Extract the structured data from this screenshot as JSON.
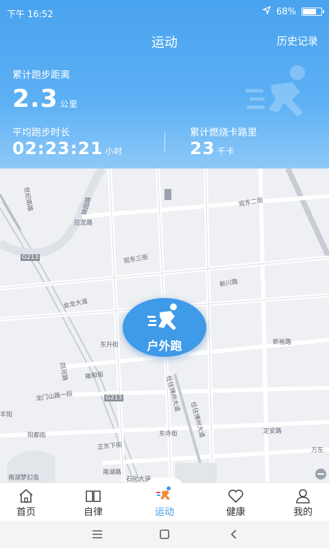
{
  "status": {
    "time": "下午 16:52",
    "battery": "68%",
    "battery_level": 0.68
  },
  "header": {
    "title": "运动",
    "history": "历史记录",
    "distance": {
      "label": "累计跑步距离",
      "value": "2.3",
      "unit": "公里"
    },
    "duration": {
      "label": "平均跑步时长",
      "value": "02:23:21",
      "unit": "小时"
    },
    "calories": {
      "label": "累计燃烧卡路里",
      "value": "23",
      "unit": "千卡"
    }
  },
  "map": {
    "labels": [
      "世纪南路",
      "锦园路",
      "应龙路",
      "G213",
      "观东三街",
      "观东二街",
      "会龙大道",
      "新川路",
      "新裕路",
      "四河路",
      "雍和街",
      "G213",
      "龙门山路一段",
      "东升街",
      "丰阳",
      "阳都街",
      "东寺街",
      "定安路",
      "正东下街",
      "南湖路",
      "石化大道",
      "万东",
      "南湖梦幻岛",
      "任住博州大道",
      "任住博州大道"
    ]
  },
  "run_button": {
    "label": "户外跑"
  },
  "tabs": [
    {
      "label": "首页",
      "icon": "home-icon"
    },
    {
      "label": "自律",
      "icon": "book-icon"
    },
    {
      "label": "运动",
      "icon": "runner-icon"
    },
    {
      "label": "健康",
      "icon": "heart-icon"
    },
    {
      "label": "我的",
      "icon": "user-icon"
    }
  ],
  "colors": {
    "accent": "#3f9ae8",
    "header_top": "#4aa3ef"
  }
}
